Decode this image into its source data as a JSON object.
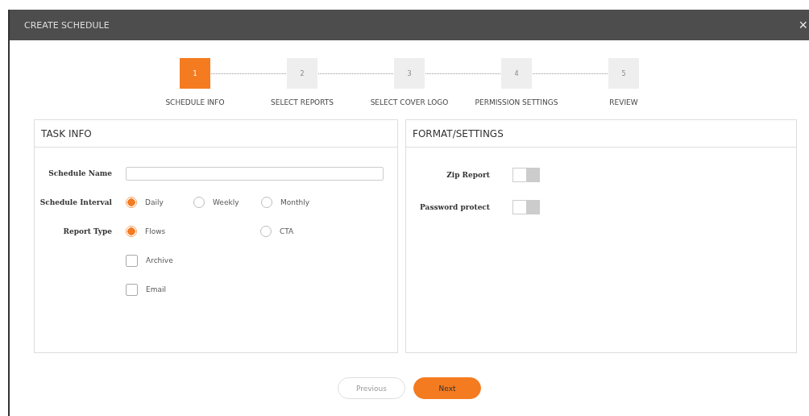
{
  "window": {
    "title": "CREATE SCHEDULE",
    "close": "×"
  },
  "steps": [
    {
      "number": "1",
      "label": "SCHEDULE INFO",
      "selected": true
    },
    {
      "number": "2",
      "label": "SELECT REPORTS",
      "selected": false
    },
    {
      "number": "3",
      "label": "SELECT COVER LOGO",
      "selected": false
    },
    {
      "number": "4",
      "label": "PERMISSION SETTINGS",
      "selected": false
    },
    {
      "number": "5",
      "label": "REVIEW",
      "selected": false
    }
  ],
  "task_info": {
    "title": "TASK INFO",
    "schedule_name": {
      "label": "Schedule Name"
    },
    "schedule_interval": {
      "label": "Schedule Interval",
      "options": [
        {
          "label": "Daily",
          "selected": true
        },
        {
          "label": "Weekly",
          "selected": false
        },
        {
          "label": "Monthly",
          "selected": false
        }
      ]
    },
    "report_type": {
      "label": "Report Type",
      "options": [
        {
          "label": "Flows",
          "selected": true
        },
        {
          "label": "CTA",
          "selected": false
        }
      ]
    },
    "checkboxes": [
      {
        "label": "Archive",
        "checked": false
      },
      {
        "label": "Email",
        "checked": false
      }
    ]
  },
  "format_settings": {
    "title": "FORMAT/SETTINGS",
    "toggles": [
      {
        "label": "Zip Report",
        "on": false
      },
      {
        "label": "Password protect",
        "on": false
      }
    ]
  },
  "buttons": [
    {
      "label": "Previous",
      "kind": "secondary"
    },
    {
      "label": "Next",
      "kind": "primary"
    }
  ]
}
